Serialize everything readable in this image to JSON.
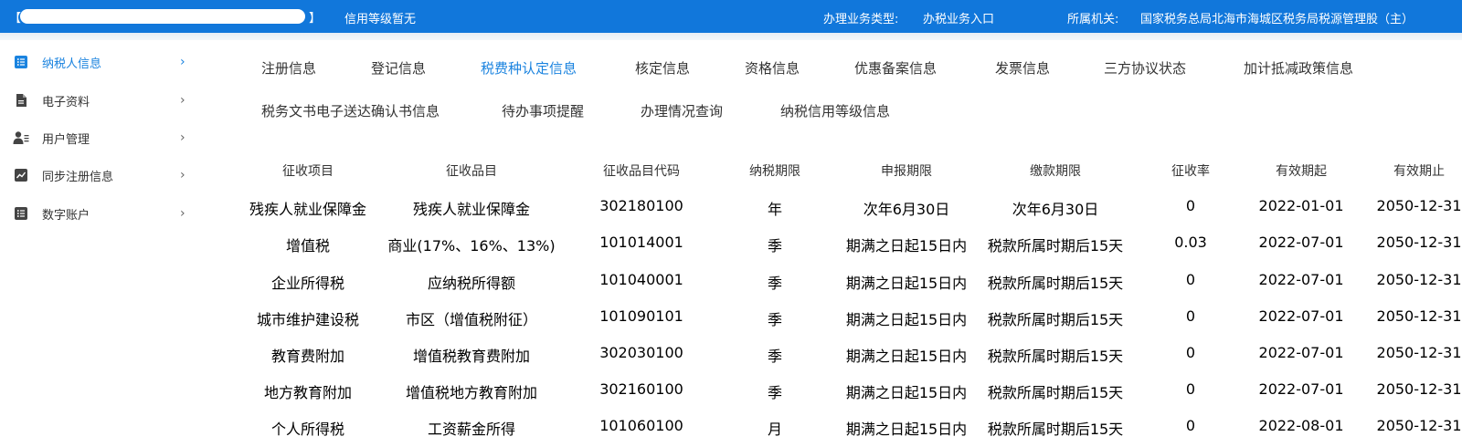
{
  "topbar": {
    "bracket_left": "【",
    "bracket_right": "】",
    "credit_level": "信用等级暂无",
    "business_type_label": "办理业务类型:",
    "business_type_value": "办税业务入口",
    "org_label": "所属机关:",
    "org_value": "国家税务总局北海市海城区税务局税源管理股（主）"
  },
  "colors": {
    "brand_blue": "#1177db",
    "accent_blue": "#1a83df"
  },
  "sidebar": {
    "items": [
      {
        "label": "纳税人信息",
        "icon": "list-icon",
        "active": true
      },
      {
        "label": "电子资料",
        "icon": "document-icon",
        "active": false
      },
      {
        "label": "用户管理",
        "icon": "user-manage-icon",
        "active": false
      },
      {
        "label": "同步注册信息",
        "icon": "line-chart-icon",
        "active": false
      },
      {
        "label": "数字账户",
        "icon": "list-icon",
        "active": false
      }
    ]
  },
  "tabs": [
    {
      "label": "注册信息",
      "active": false
    },
    {
      "label": "登记信息",
      "active": false
    },
    {
      "label": "税费种认定信息",
      "active": true
    },
    {
      "label": "核定信息",
      "active": false
    },
    {
      "label": "资格信息",
      "active": false
    },
    {
      "label": "优惠备案信息",
      "active": false
    },
    {
      "label": "发票信息",
      "active": false
    },
    {
      "label": "三方协议状态",
      "active": false
    },
    {
      "label": "加计抵减政策信息",
      "active": false
    },
    {
      "label": "税务文书电子送达确认书信息",
      "active": false
    },
    {
      "label": "待办事项提醒",
      "active": false
    },
    {
      "label": "办理情况查询",
      "active": false
    },
    {
      "label": "纳税信用等级信息",
      "active": false
    }
  ],
  "table": {
    "headers": [
      "征收项目",
      "征收品目",
      "征收品目代码",
      "纳税期限",
      "申报期限",
      "缴款期限",
      "征收率",
      "有效期起",
      "有效期止"
    ],
    "rows": [
      [
        "残疾人就业保障金",
        "残疾人就业保障金",
        "302180100",
        "年",
        "次年6月30日",
        "次年6月30日",
        "0",
        "2022-01-01",
        "2050-12-31"
      ],
      [
        "增值税",
        "商业(17%、16%、13%)",
        "101014001",
        "季",
        "期满之日起15日内",
        "税款所属时期后15天",
        "0.03",
        "2022-07-01",
        "2050-12-31"
      ],
      [
        "企业所得税",
        "应纳税所得额",
        "101040001",
        "季",
        "期满之日起15日内",
        "税款所属时期后15天",
        "0",
        "2022-07-01",
        "2050-12-31"
      ],
      [
        "城市维护建设税",
        "市区（增值税附征）",
        "101090101",
        "季",
        "期满之日起15日内",
        "税款所属时期后15天",
        "0",
        "2022-07-01",
        "2050-12-31"
      ],
      [
        "教育费附加",
        "增值税教育费附加",
        "302030100",
        "季",
        "期满之日起15日内",
        "税款所属时期后15天",
        "0",
        "2022-07-01",
        "2050-12-31"
      ],
      [
        "地方教育附加",
        "增值税地方教育附加",
        "302160100",
        "季",
        "期满之日起15日内",
        "税款所属时期后15天",
        "0",
        "2022-07-01",
        "2050-12-31"
      ],
      [
        "个人所得税",
        "工资薪金所得",
        "101060100",
        "月",
        "期满之日起15日内",
        "税款所属时期后15天",
        "0",
        "2022-08-01",
        "2050-12-31"
      ]
    ]
  }
}
